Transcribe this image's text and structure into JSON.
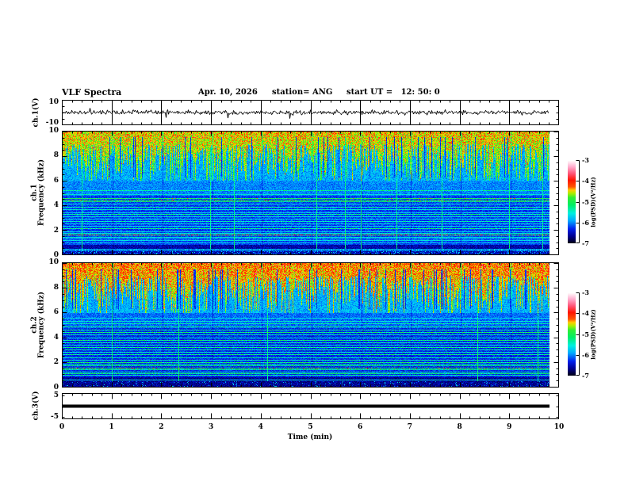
{
  "header": {
    "title": "VLF Spectra",
    "date": "Apr. 10, 2026",
    "station": "station= ANG",
    "start_ut": "start UT =   12: 50: 0"
  },
  "colors": {
    "foreground": "#000000",
    "background": "#ffffff",
    "palette": [
      [
        0,
        "#000018"
      ],
      [
        0.08,
        "#000090"
      ],
      [
        0.17,
        "#0020ee"
      ],
      [
        0.27,
        "#00aaff"
      ],
      [
        0.36,
        "#00f0e0"
      ],
      [
        0.46,
        "#00ee66"
      ],
      [
        0.55,
        "#33ee33"
      ],
      [
        0.6,
        "#aaee00"
      ],
      [
        0.64,
        "#ffcc00"
      ],
      [
        0.68,
        "#ff5500"
      ],
      [
        0.76,
        "#ff1500"
      ],
      [
        0.84,
        "#ff5577"
      ],
      [
        0.92,
        "#ffaacc"
      ],
      [
        1,
        "#ffffff"
      ]
    ]
  },
  "x_axis": {
    "label": "Time (min)",
    "lim": [
      0,
      10
    ],
    "tick_labels": [
      "0",
      "1",
      "2",
      "3",
      "4",
      "5",
      "6",
      "7",
      "8",
      "9",
      "10"
    ],
    "minor_per_major": 5,
    "data_end_min": 9.8
  },
  "chart_data": [
    {
      "type": "line",
      "name": "ch1_waveform",
      "ylabel": "ch.1(V)",
      "ylim": [
        -12,
        12
      ],
      "ytick_values": [
        10,
        -10
      ],
      "ytick_labels": [
        "10",
        "-10"
      ],
      "signal": {
        "baseline_V": 0,
        "noise_amplitude_V": 1.5,
        "spike_amplitude_V": 6,
        "spike_probability": 0.006
      },
      "seed": 11
    },
    {
      "type": "heatmap",
      "name": "ch1_spectrogram",
      "ylabel_line1": "ch.1",
      "ylabel_line2": "Frequency (kHz)",
      "ylim": [
        0,
        10
      ],
      "ytick_values": [
        10,
        8,
        6,
        4,
        2,
        0
      ],
      "ytick_labels": [
        "10",
        "8",
        "6",
        "4",
        "2",
        "0"
      ],
      "colorbar": {
        "label": "log(PSD)(V²/Hz)",
        "range": [
          -7,
          -3
        ],
        "tick_labels": [
          "-3",
          "-4",
          "-5",
          "-6",
          "-7"
        ]
      },
      "grass": {
        "f_lo": 6,
        "f_hi": 10,
        "base": 0.46,
        "cap": 0.5,
        "dark_streak_prob": 0.07,
        "burst_prob": 0.012
      },
      "background_bands": [
        {
          "f_lo": 6,
          "f_hi": 10,
          "base": 0.22
        },
        {
          "f_lo": 4.8,
          "f_hi": 6,
          "base": 0.2
        },
        {
          "f_lo": 0.8,
          "f_hi": 4.8,
          "base": 0.15
        },
        {
          "f_lo": 0,
          "f_hi": 0.8,
          "base": 0.06
        }
      ],
      "bottom_speckle": 0.25,
      "harmonic_lines_khz": [
        [
          5.2,
          0.42
        ],
        [
          4.9,
          0.36
        ],
        [
          4.6,
          0.48
        ],
        [
          4.45,
          0.52
        ],
        [
          4.3,
          0.46
        ],
        [
          4.1,
          0.34
        ],
        [
          3.9,
          0.4
        ],
        [
          3.7,
          0.36
        ],
        [
          3.45,
          0.33
        ],
        [
          3.3,
          0.42
        ],
        [
          3.1,
          0.36
        ],
        [
          2.9,
          0.32
        ],
        [
          2.7,
          0.38
        ],
        [
          2.5,
          0.34
        ],
        [
          2.3,
          0.32
        ],
        [
          2.1,
          0.44
        ],
        [
          1.9,
          0.34
        ],
        [
          1.75,
          0.36
        ],
        [
          1.6,
          0.58
        ],
        [
          1.45,
          0.36
        ],
        [
          1.3,
          0.32
        ],
        [
          1.15,
          0.34
        ],
        [
          1.0,
          0.32
        ],
        [
          0.45,
          0.3
        ],
        [
          0.3,
          0.28
        ]
      ],
      "seed": 21
    },
    {
      "type": "heatmap",
      "name": "ch2_spectrogram",
      "ylabel_line1": "ch.2",
      "ylabel_line2": "Frequency (kHz)",
      "ylim": [
        0,
        10
      ],
      "ytick_values": [
        10,
        8,
        6,
        4,
        2,
        0
      ],
      "ytick_labels": [
        "10",
        "8",
        "6",
        "4",
        "2",
        "0"
      ],
      "colorbar": {
        "label": "log(PSD)(V²/Hz)",
        "range": [
          -7,
          -3
        ],
        "tick_labels": [
          "-3",
          "-4",
          "-5",
          "-6",
          "-7"
        ]
      },
      "grass": {
        "f_lo": 6,
        "f_hi": 10,
        "base": 0.5,
        "cap": 0.56,
        "dark_streak_prob": 0.08,
        "burst_prob": 0.012
      },
      "background_bands": [
        {
          "f_lo": 6,
          "f_hi": 10,
          "base": 0.22
        },
        {
          "f_lo": 4.8,
          "f_hi": 6,
          "base": 0.18
        },
        {
          "f_lo": 0.8,
          "f_hi": 4.8,
          "base": 0.13
        },
        {
          "f_lo": 0,
          "f_hi": 0.8,
          "base": 0.04
        }
      ],
      "bottom_speckle": 0.08,
      "harmonic_lines_khz": [
        [
          5.6,
          0.34
        ],
        [
          5.35,
          0.36
        ],
        [
          5.1,
          0.4
        ],
        [
          4.85,
          0.44
        ],
        [
          4.6,
          0.42
        ],
        [
          4.4,
          0.46
        ],
        [
          4.2,
          0.4
        ],
        [
          4.0,
          0.36
        ],
        [
          3.8,
          0.44
        ],
        [
          3.6,
          0.4
        ],
        [
          3.4,
          0.38
        ],
        [
          3.2,
          0.44
        ],
        [
          3.0,
          0.4
        ],
        [
          2.8,
          0.38
        ],
        [
          2.6,
          0.44
        ],
        [
          2.4,
          0.4
        ],
        [
          2.2,
          0.38
        ],
        [
          2.0,
          0.46
        ],
        [
          1.85,
          0.4
        ],
        [
          1.7,
          0.44
        ],
        [
          1.55,
          0.52
        ],
        [
          1.4,
          0.42
        ],
        [
          1.25,
          0.4
        ],
        [
          1.1,
          0.44
        ],
        [
          0.95,
          0.4
        ],
        [
          0.55,
          0.34
        ]
      ],
      "seed": 42
    },
    {
      "type": "line",
      "name": "ch3_waveform",
      "ylabel": "ch.3(V)",
      "ylim": [
        -6,
        6
      ],
      "ytick_values": [
        5,
        -5
      ],
      "ytick_labels": [
        "5",
        "-5"
      ],
      "signal": {
        "baseline_V": 0,
        "noise_amplitude_V": 0,
        "constant": true
      },
      "seed": 33
    }
  ],
  "layout_note": "four stacked panels sharing time axis; two colorbars right of spectrograms"
}
